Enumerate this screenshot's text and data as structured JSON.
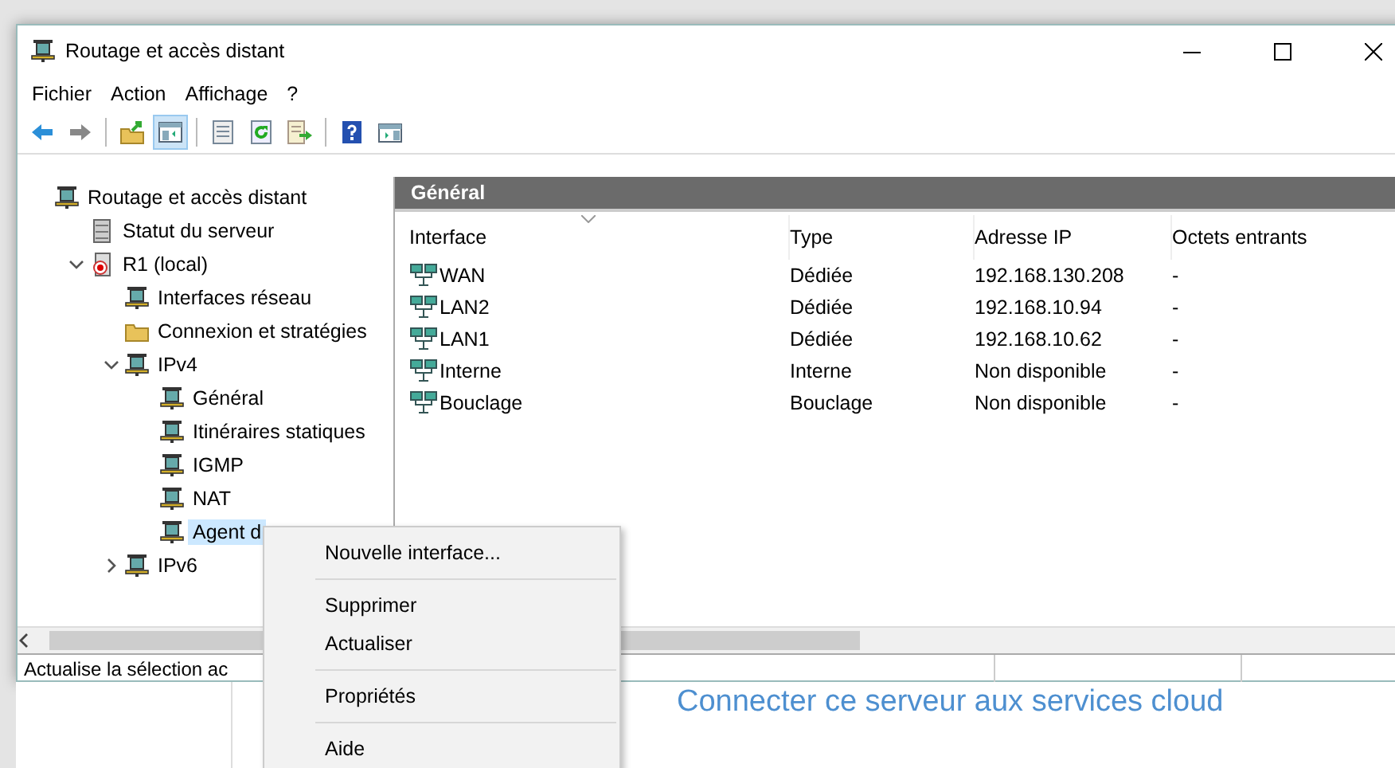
{
  "window": {
    "title": "Routage et accès distant"
  },
  "menu_bar": [
    "Fichier",
    "Action",
    "Affichage",
    "?"
  ],
  "toolbar": [
    {
      "buttons": [
        {
          "kind": "back",
          "pressed": false
        },
        {
          "kind": "forward",
          "pressed": false
        }
      ]
    },
    {
      "buttons": [
        {
          "kind": "up",
          "pressed": false
        },
        {
          "kind": "tree-pane",
          "pressed": true
        }
      ]
    },
    {
      "buttons": [
        {
          "kind": "properties",
          "pressed": false
        },
        {
          "kind": "refresh",
          "pressed": false
        },
        {
          "kind": "export",
          "pressed": false
        }
      ]
    },
    {
      "buttons": [
        {
          "kind": "help",
          "pressed": false
        },
        {
          "kind": "action-pane",
          "pressed": false
        }
      ]
    }
  ],
  "tree": {
    "items": [
      {
        "label": "Routage et accès distant",
        "kind": "router",
        "selected": false,
        "children": [
          {
            "label": "Statut du serveur",
            "kind": "server",
            "selected": false
          },
          {
            "label": "R1 (local)",
            "kind": "local-server",
            "selected": false,
            "expanded": true,
            "children": [
              {
                "label": "Interfaces réseau",
                "kind": "router",
                "selected": false
              },
              {
                "label": "Connexion et stratégies",
                "kind": "folder",
                "selected": false
              },
              {
                "label": "IPv4",
                "kind": "router",
                "selected": false,
                "expanded": true,
                "children": [
                  {
                    "label": "Général",
                    "kind": "router",
                    "selected": false
                  },
                  {
                    "label": "Itinéraires statiques",
                    "kind": "router",
                    "selected": false
                  },
                  {
                    "label": "IGMP",
                    "kind": "router",
                    "selected": false
                  },
                  {
                    "label": "NAT",
                    "kind": "router",
                    "selected": false
                  },
                  {
                    "label": "Agent d",
                    "kind": "router",
                    "selected": true
                  }
                ]
              },
              {
                "label": "IPv6",
                "kind": "router",
                "selected": false,
                "expanded": false
              }
            ]
          }
        ]
      }
    ]
  },
  "panel": {
    "title": "Général",
    "columns": [
      {
        "label": "Interface",
        "sorted": true
      },
      {
        "label": "Type",
        "sorted": false
      },
      {
        "label": "Adresse IP",
        "sorted": false
      },
      {
        "label": "Octets entrants",
        "sorted": false
      }
    ],
    "rows": [
      [
        "WAN",
        "Dédiée",
        "192.168.130.208",
        "-"
      ],
      [
        "LAN2",
        "Dédiée",
        "192.168.10.94",
        "-"
      ],
      [
        "LAN1",
        "Dédiée",
        "192.168.10.62",
        "-"
      ],
      [
        "Interne",
        "Interne",
        "Non disponible",
        "-"
      ],
      [
        "Bouclage",
        "Bouclage",
        "Non disponible",
        "-"
      ]
    ]
  },
  "status_bar": {
    "text": "Actualise la sélection ac"
  },
  "context_menu": {
    "groups": [
      [
        "Nouvelle interface..."
      ],
      [
        "Supprimer",
        "Actualiser"
      ],
      [
        "Propriétés"
      ],
      [
        "Aide"
      ]
    ]
  },
  "background": {
    "link": "Connecter ce serveur aux services cloud"
  }
}
